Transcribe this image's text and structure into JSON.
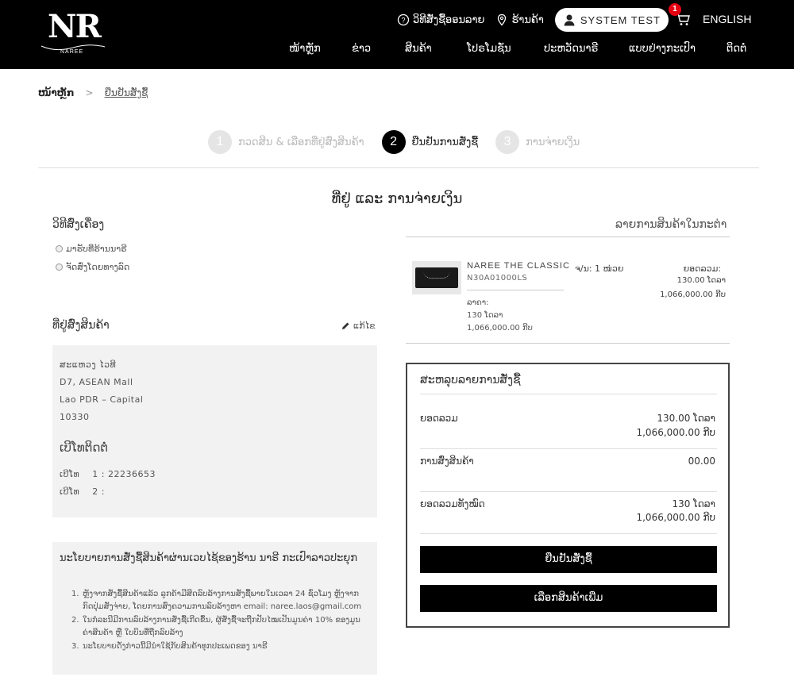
{
  "header": {
    "logo_text": "NR",
    "logo_sub": "NAREE",
    "how_to_order": "ວິທີສັ່ງຊື້ອອນລາຍ",
    "store": "ຮ້ານຄ້າ",
    "user_name": "SYSTEM TEST",
    "cart_count": "1",
    "language": "ENGLISH",
    "nav": [
      "ໜ້າຫຼັກ",
      "ຂ່າວ",
      "ສິນຄ້າ",
      "ໂປຣໂມຊັ່ນ",
      "ປະຫວັດນາຣີ",
      "ແບບຢ່າງກະເປົາ",
      "ຕິດຕໍ່"
    ]
  },
  "breadcrumb": {
    "home": "ໜ້າຫຼັກ",
    "sep": ">",
    "current": "ຢືນຢັນສັ່ງຊື້"
  },
  "steps": [
    {
      "num": "1",
      "label": "ກວດສິນ & ເລືອກທີ່ຢູ່ສົ່ງສິນຄ້າ",
      "active": false
    },
    {
      "num": "2",
      "label": "ຢືນຢັນການສັ່ງຊື້",
      "active": true
    },
    {
      "num": "3",
      "label": "ການຈ່າຍເງິນ",
      "active": false
    }
  ],
  "section_title": "ທີ່ຢູ່ ແລະ ການຈ່າຍເງິນ",
  "shipping": {
    "title": "ວິທີສົ່ງເຄື່ອງ",
    "options": [
      "ມາຮັບທີ່ຮ້ານນາຣີ",
      "ຈັດສົ່ງໂດຍທາງລົດ"
    ]
  },
  "address": {
    "title": "ທີ່ຢູ່ສົ່ງສິນຄ້າ",
    "edit": "ແກ້ໄຂ",
    "lines": [
      "ສະແຫວງ ໄວທີ",
      "D7, ASEAN Mall",
      "Lao PDR – Capital",
      "10330"
    ],
    "phone_title": "ເບີໂທຕິດຕໍ່",
    "phone1_label": "ເບີໂທ",
    "phone1_value": "1 : 22236653",
    "phone2_label": "ເບີໂທ",
    "phone2_value": "2 :"
  },
  "policy": {
    "title": "ນະໂຍບາຍການສັ່ງຊື້ສິນຄ້າຜ່ານເວບໄຊ້ຂອງຮ້ານ ນາຣີ ກະເປົາລາວປະຍຸກ",
    "items": [
      "ຫຼັງຈາກສັ່ງຊື້ສິນຄ້າແລ້ວ ລູກຄ້າມີສິດລົບລ້າງການສັ່ງຊື້ພາຍໃນເວລາ 24 ຊົ່ວໂມງ ຫຼັງຈາກກົດປຸ່ມສັ່ງຈ່າຍ, ໂດຍການສົ່ງຄວາມການລົບລ້າງຫາ email: naree.laos@gmail.com",
      "ໃນກໍລະນີມີການລົບລ້າງການສັ່ງຊື້ເກີດຂຶ້ນ, ຜູ້ສັ່ງຊື້ຈະຖືກປັບໄໝເປັນມູນຄ່າ 10% ຂອງມູນຄ່າສິນຄ້າ ຫຼື ໃບບິນທີ່ຖືກລົບລ້າງ",
      "ນະໂຍບາຍດັ່ງກ່າວນີ້ມີນຳໃຊ້ກັບສິນຄ້າທຸກປະເພດຂອງ ນາຣີ"
    ]
  },
  "cart": {
    "title": "ລາຍການສິນຄ້າໃນກະຕ່າ",
    "product_name": "NAREE THE CLASSIC",
    "product_code": "N30A01000LS",
    "price_label": "ລາຄາ:",
    "price_thb": "130 ໂດລາ",
    "price_lak": "1,066,000.00 ກີບ",
    "qty": "ຈ/ນ: 1 ໜ່ວຍ",
    "subtotal_label": "ຍອດລວມ:",
    "subtotal_thb": "130.00 ໂດລາ",
    "subtotal_lak": "1,066,000.00 ກີບ"
  },
  "summary": {
    "title": "ສະຫລຸບລາຍການສັ່ງຊື້",
    "subtotal_label": "ຍອດລວມ",
    "subtotal_thb": "130.00 ໂດລາ",
    "subtotal_lak": "1,066,000.00 ກີບ",
    "shipping_label": "ການສົ່ງສິນຄ້າ",
    "shipping_value": "00.00",
    "total_label": "ຍອດລວມທັງໝົດ",
    "total_thb": "130 ໂດລາ",
    "total_lak": "1,066,000.00 ກີບ",
    "confirm_button": "ຢືນຢັນສັ່ງຊື້",
    "continue_button": "ເລືອກສິນຄ້າເພີ່ມ"
  }
}
